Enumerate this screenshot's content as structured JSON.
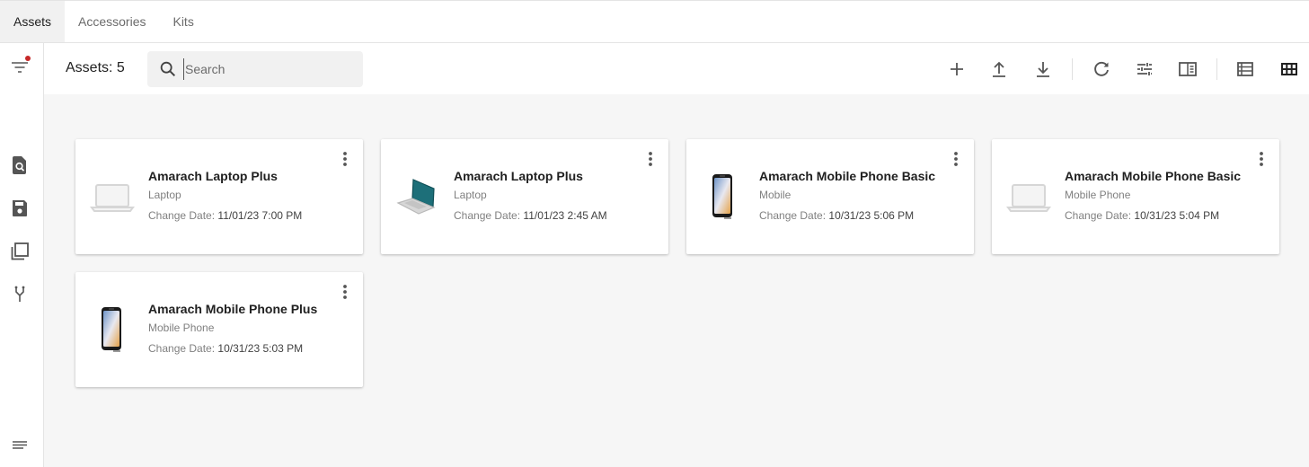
{
  "tabs": [
    {
      "label": "Assets",
      "active": true
    },
    {
      "label": "Accessories",
      "active": false
    },
    {
      "label": "Kits",
      "active": false
    }
  ],
  "toolbar": {
    "count_label": "Assets: 5",
    "search_placeholder": "Search"
  },
  "sidebar_icons": [
    "filter-icon",
    "search-document-icon",
    "save-icon",
    "copy-icon",
    "merge-icon",
    "notes-icon"
  ],
  "toolbar_icons": [
    "add-icon",
    "upload-icon",
    "download-icon",
    "refresh-icon",
    "tune-icon",
    "panel-toggle-icon",
    "list-view-icon",
    "grid-view-icon"
  ],
  "colors": {
    "accent_dot": "#c62828",
    "tab_active_bg": "#f1f1f1",
    "content_bg": "#f6f6f6"
  },
  "assets": [
    {
      "name": "Amarach Laptop Plus",
      "type": "Laptop",
      "date_label": "Change Date:",
      "date": "11/01/23 7:00 PM",
      "icon": "laptop-outline-icon"
    },
    {
      "name": "Amarach Laptop Plus",
      "type": "Laptop",
      "date_label": "Change Date:",
      "date": "11/01/23 2:45 AM",
      "icon": "laptop-teal-icon"
    },
    {
      "name": "Amarach Mobile Phone Basic",
      "type": "Mobile",
      "date_label": "Change Date:",
      "date": "10/31/23 5:06 PM",
      "icon": "mobile-phone-icon"
    },
    {
      "name": "Amarach Mobile Phone Basic",
      "type": "Mobile Phone",
      "date_label": "Change Date:",
      "date": "10/31/23 5:04 PM",
      "icon": "laptop-outline-icon"
    },
    {
      "name": "Amarach Mobile Phone Plus",
      "type": "Mobile Phone",
      "date_label": "Change Date:",
      "date": "10/31/23 5:03 PM",
      "icon": "mobile-phone-icon"
    }
  ]
}
